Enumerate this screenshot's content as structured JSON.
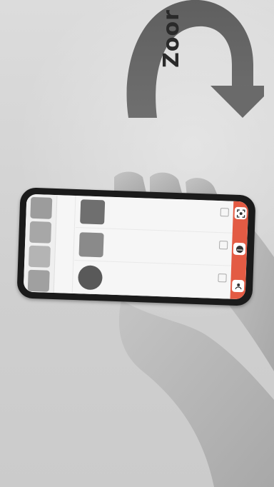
{
  "overlay": {
    "zoom_text": "Zoor"
  }
}
